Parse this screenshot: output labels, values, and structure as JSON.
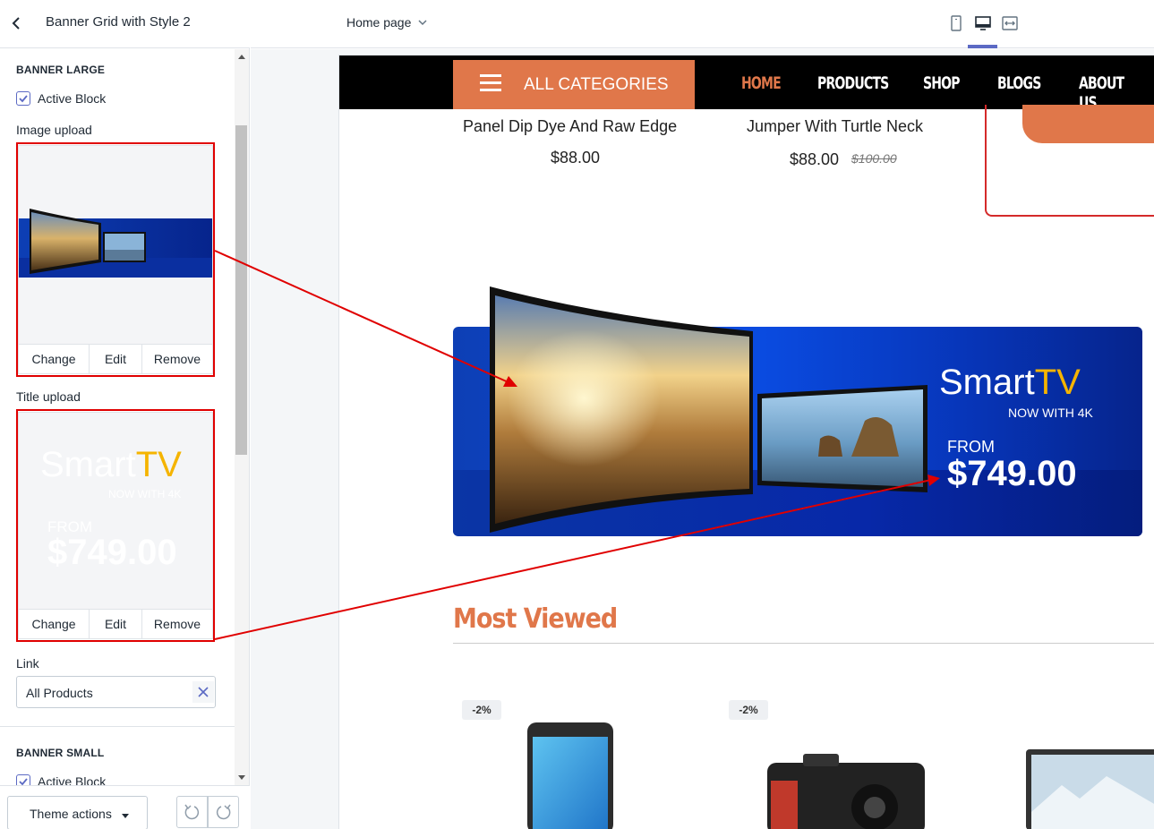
{
  "sidebar": {
    "title": "Banner Grid with Style 2",
    "banner_large": {
      "heading": "BANNER LARGE",
      "active_label": "Active Block",
      "image_label": "Image upload",
      "title_label": "Title upload",
      "actions": [
        "Change",
        "Edit",
        "Remove"
      ],
      "title_preview": {
        "smart": "Smart",
        "tv": "TV",
        "sub": "NOW WITH 4K",
        "from": "FROM",
        "price": "$749.00"
      },
      "link_label": "Link",
      "link_value": "All Products"
    },
    "banner_small": {
      "heading": "BANNER SMALL",
      "active_label": "Active Block"
    },
    "footer": {
      "theme_actions": "Theme actions"
    }
  },
  "topbar": {
    "page_select": "Home page"
  },
  "store": {
    "nav": {
      "all_categories": "ALL CATEGORIES",
      "links": [
        "HOME",
        "PRODUCTS",
        "SHOP",
        "BLOGS",
        "ABOUT US"
      ]
    },
    "products": [
      {
        "name": "Panel Dip Dye And Raw Edge",
        "price": "$88.00"
      },
      {
        "name": "Jumper With Turtle Neck",
        "price": "$88.00",
        "old_price": "$100.00"
      }
    ],
    "banner": {
      "smart": "Smart",
      "tv": "TV",
      "sub": "NOW WITH 4K",
      "from": "FROM",
      "price": "$749.00"
    },
    "section_title": "Most Viewed",
    "badges": [
      "-2%",
      "-2%"
    ]
  },
  "colors": {
    "accent": "#e0774a",
    "highlight": "#e00000",
    "brand_blue": "#0a4be0",
    "tv_yellow": "#f5b400"
  }
}
